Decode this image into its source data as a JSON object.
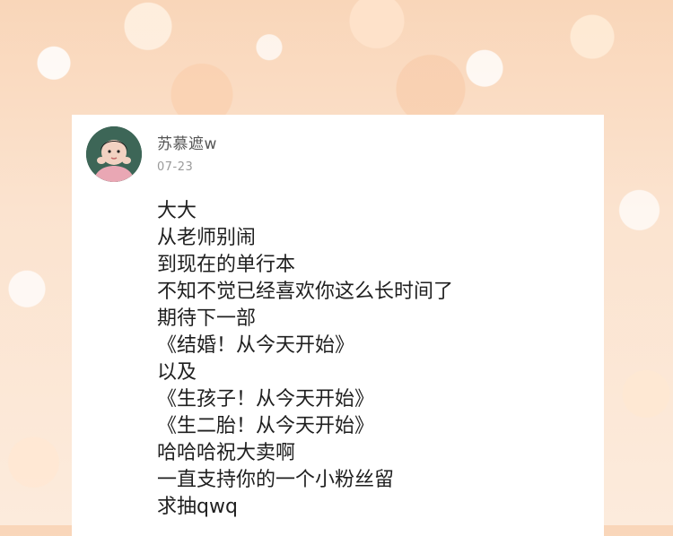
{
  "post": {
    "author": "苏慕遮w",
    "date": "07-23",
    "lines": [
      "大大",
      "从老师别闹",
      "到现在的单行本",
      "不知不觉已经喜欢你这么长时间了",
      "期待下一部",
      "《结婚！从今天开始》",
      "以及",
      "《生孩子！从今天开始》",
      "《生二胎！从今天开始》",
      "哈哈哈祝大卖啊",
      "一直支持你的一个小粉丝留",
      "求抽qwq"
    ]
  }
}
